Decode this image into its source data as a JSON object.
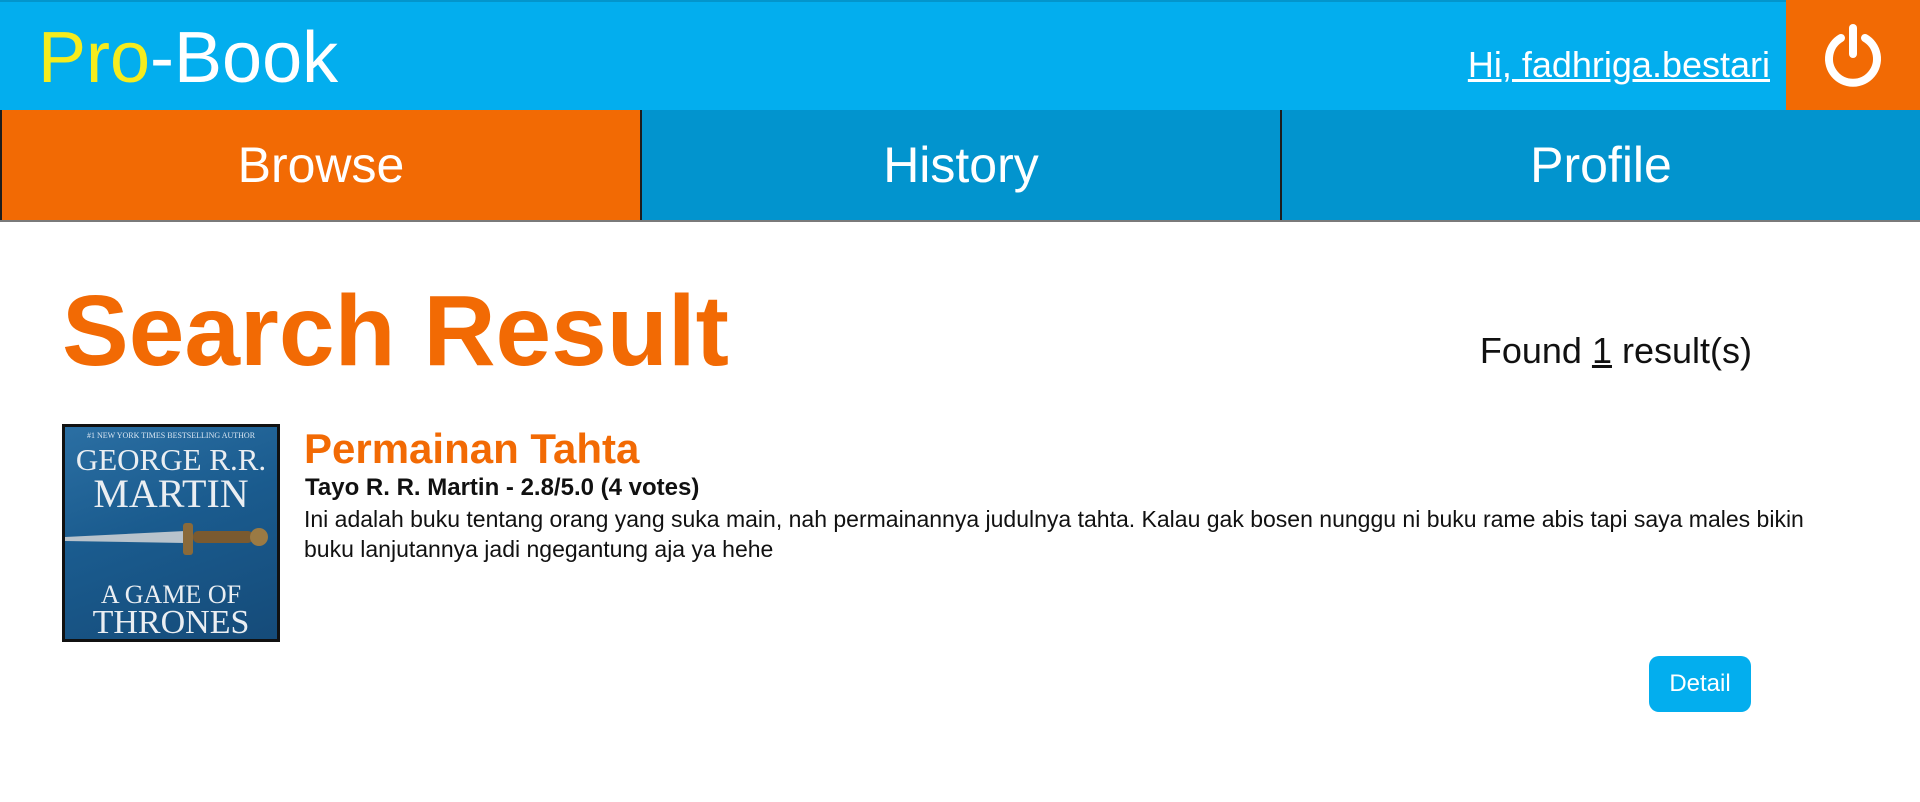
{
  "header": {
    "logo_part1": "Pro",
    "logo_part2": "-Book",
    "greeting": "Hi, fadhriga.bestari",
    "logout_icon": "power-icon"
  },
  "nav": {
    "tabs": [
      {
        "label": "Browse",
        "active": true
      },
      {
        "label": "History",
        "active": false
      },
      {
        "label": "Profile",
        "active": false
      }
    ]
  },
  "main": {
    "title": "Search Result",
    "found_prefix": "Found ",
    "found_count": "1",
    "found_suffix": " result(s)"
  },
  "results": [
    {
      "cover": {
        "topline": "#1 NEW YORK TIMES BESTSELLING AUTHOR",
        "author_line1": "GEORGE R.R.",
        "author_line2": "MARTIN",
        "title_line1": "A GAME OF",
        "title_line2": "THRONES"
      },
      "title": "Permainan Tahta",
      "meta": "Tayo R. R. Martin - 2.8/5.0 (4 votes)",
      "description": "Ini adalah buku tentang orang yang suka main, nah permainannya judulnya tahta. Kalau gak bosen nunggu ni buku rame abis tapi saya males bikin buku lanjutannya jadi ngegantung aja ya hehe",
      "button": "Detail"
    }
  ],
  "colors": {
    "header_blue": "#03aeee",
    "nav_blue": "#0294ce",
    "accent_orange": "#f26a04",
    "logo_yellow": "#f6ec1d"
  }
}
